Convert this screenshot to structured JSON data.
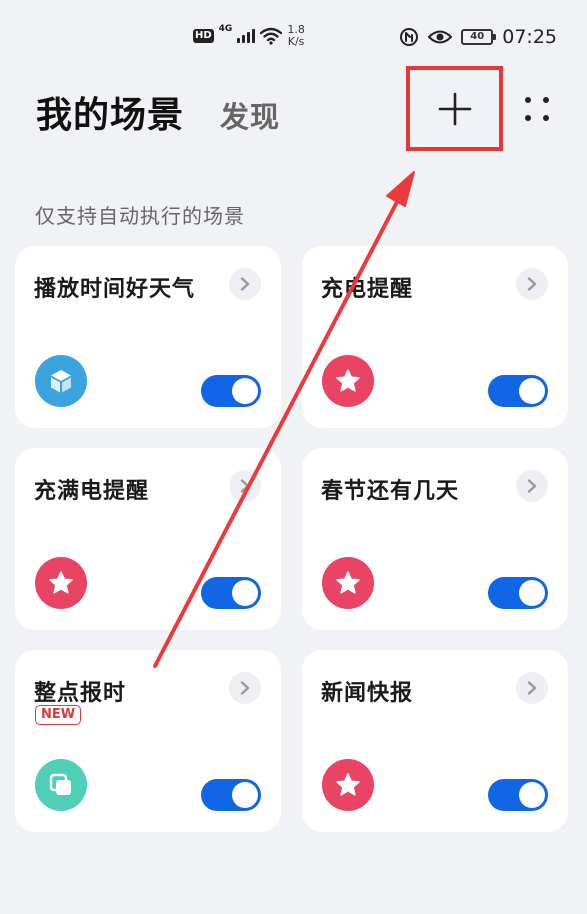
{
  "status_bar": {
    "hd": "HD",
    "network": "4G",
    "speed_value": "1.8",
    "speed_unit": "K/s",
    "battery": "40",
    "time": "07:25"
  },
  "header": {
    "title": "我的场景",
    "discover_tab": "发现"
  },
  "section_label": "仅支持自动执行的场景",
  "colors": {
    "accent_blue": "#1166e6",
    "highlight_red": "#e8373a",
    "icon_pink": "#e94464",
    "icon_sky": "#3ba3e0",
    "icon_teal": "#4dcfb8"
  },
  "cards": [
    {
      "title": "播放时间好天气",
      "badge": "",
      "icon": "cube-icon",
      "icon_color": "#3ba3e0",
      "enabled": true
    },
    {
      "title": "充电提醒",
      "badge": "",
      "icon": "star-icon",
      "icon_color": "#e94464",
      "enabled": true
    },
    {
      "title": "充满电提醒",
      "badge": "",
      "icon": "star-icon",
      "icon_color": "#e94464",
      "enabled": true
    },
    {
      "title": "春节还有几天",
      "badge": "",
      "icon": "star-icon",
      "icon_color": "#e94464",
      "enabled": true
    },
    {
      "title": "整点报时",
      "badge": "NEW",
      "icon": "layers-icon",
      "icon_color": "#4dcfb8",
      "enabled": true
    },
    {
      "title": "新闻快报",
      "badge": "",
      "icon": "star-icon",
      "icon_color": "#e94464",
      "enabled": true
    }
  ]
}
